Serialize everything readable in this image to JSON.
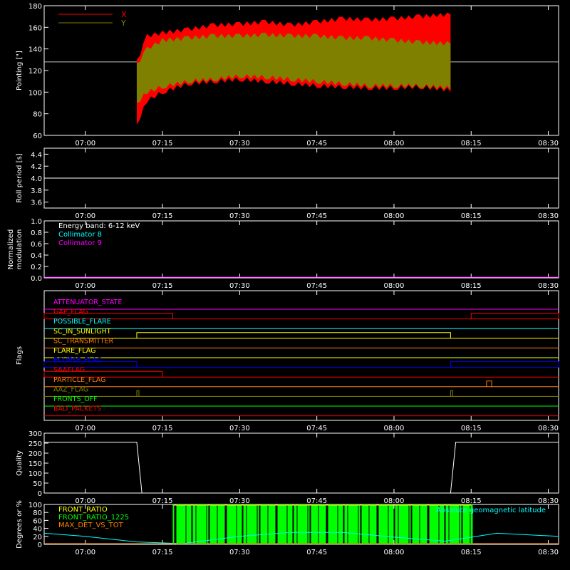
{
  "x_ticks": [
    "07:00",
    "07:15",
    "07:30",
    "07:45",
    "08:00",
    "08:15",
    "08:30"
  ],
  "colors": {
    "bg": "#000000",
    "axis": "#ffffff",
    "red": "#ff0000",
    "olive": "#808000",
    "cyan": "#00ffff",
    "magenta": "#ff00ff",
    "green": "#00ff00",
    "yellow": "#ffff00",
    "orange": "#ff7f00",
    "blue": "#0000ff"
  },
  "chart_data": [
    {
      "id": "pointing",
      "type": "area",
      "ylabel": "Pointing [\"]",
      "ylim": [
        60,
        180
      ],
      "yticks": [
        "60",
        "80",
        "100",
        "120",
        "140",
        "160",
        "180"
      ],
      "xlabel": "",
      "legend": {
        "placement": "top-left",
        "entries": [
          {
            "label": "X",
            "color": "#ff0000"
          },
          {
            "label": "Y",
            "color": "#808000"
          }
        ]
      },
      "baseline": 128,
      "x": [
        "07:10",
        "07:12",
        "07:15",
        "07:20",
        "07:25",
        "07:30",
        "07:35",
        "07:40",
        "07:45",
        "07:50",
        "07:55",
        "08:00",
        "08:05",
        "08:11"
      ],
      "series": [
        {
          "name": "X",
          "upper": [
            128,
            152,
            155,
            158,
            162,
            163,
            165,
            162,
            165,
            168,
            167,
            168,
            170,
            172
          ],
          "lower": [
            70,
            92,
            100,
            108,
            110,
            112,
            110,
            108,
            106,
            105,
            104,
            104,
            105,
            102
          ]
        },
        {
          "name": "Y",
          "upper": [
            125,
            140,
            148,
            150,
            152,
            152,
            153,
            152,
            152,
            150,
            150,
            148,
            146,
            145
          ],
          "lower": [
            90,
            100,
            105,
            110,
            112,
            115,
            114,
            112,
            110,
            108,
            106,
            106,
            106,
            104
          ]
        }
      ]
    },
    {
      "id": "roll",
      "type": "line",
      "ylabel": "Roll period [s]",
      "ylim": [
        3.5,
        4.5
      ],
      "yticks": [
        "3.6",
        "3.8",
        "4.0",
        "4.2",
        "4.4"
      ],
      "series": [
        {
          "name": "",
          "x": [
            "06:52",
            "08:32"
          ],
          "values": [
            4.0,
            4.0
          ]
        }
      ]
    },
    {
      "id": "modulation",
      "type": "line",
      "ylabel": "Normalized modulation",
      "ylim": [
        0,
        1
      ],
      "yticks": [
        "0.0",
        "0.2",
        "0.4",
        "0.6",
        "0.8",
        "1.0"
      ],
      "legend": {
        "placement": "top-left",
        "entries": [
          {
            "label": "Energy band: 6-12 keV",
            "color": "#ffffff"
          },
          {
            "label": "Collimator 8",
            "color": "#00ffff"
          },
          {
            "label": "Collimator 9",
            "color": "#ff00ff"
          }
        ]
      },
      "series": [
        {
          "name": "Collimator 9",
          "x": [
            "06:52",
            "08:32"
          ],
          "values": [
            0,
            0
          ]
        }
      ]
    },
    {
      "id": "flags",
      "type": "line",
      "ylabel": "Flags",
      "flags": [
        {
          "label": "ATTENUATOR_STATE",
          "color": "#ff00ff",
          "segments": []
        },
        {
          "label": "GAP_FLAG",
          "color": "#ff0000",
          "segments": [
            [
              "06:52",
              "07:17"
            ],
            [
              "08:15",
              "08:32"
            ]
          ]
        },
        {
          "label": "POSSIBLE_FLARE",
          "color": "#00ffff",
          "segments": []
        },
        {
          "label": "SC_IN_SUNLIGHT",
          "color": "#ffff00",
          "segments": [
            [
              "07:10",
              "08:11"
            ]
          ]
        },
        {
          "label": "SC_TRANSMITTER",
          "color": "#ff7f00",
          "segments": []
        },
        {
          "label": "FLARE_FLAG",
          "color": "#ffff00",
          "segments": []
        },
        {
          "label": "ECLIPSE_FLAG",
          "color": "#0000ff",
          "segments": [
            [
              "06:52",
              "07:10"
            ],
            [
              "08:11",
              "08:32"
            ]
          ]
        },
        {
          "label": "SAAFLAG",
          "color": "#ff0000",
          "segments": [
            [
              "06:52",
              "07:15"
            ]
          ]
        },
        {
          "label": "PARTICLE_FLAG",
          "color": "#ff7f00",
          "segments": [
            [
              "08:18",
              "08:19"
            ]
          ]
        },
        {
          "label": "AAZ_FLAG",
          "color": "#808000",
          "segments": [
            [
              "07:10",
              "07:10"
            ],
            [
              "08:11",
              "08:11"
            ]
          ]
        },
        {
          "label": "FRONTS_OFF",
          "color": "#00ff00",
          "segments": []
        },
        {
          "label": "BAD_PACKETS",
          "color": "#ff0000",
          "segments": []
        }
      ]
    },
    {
      "id": "quality",
      "type": "line",
      "ylabel": "Quality",
      "ylim": [
        0,
        300
      ],
      "yticks": [
        "0",
        "50",
        "100",
        "150",
        "200",
        "250",
        "300"
      ],
      "series": [
        {
          "name": "",
          "x": [
            "06:52",
            "07:10",
            "07:11",
            "08:11",
            "08:12",
            "08:32"
          ],
          "values": [
            255,
            255,
            0,
            0,
            255,
            255
          ]
        }
      ]
    },
    {
      "id": "ratio",
      "type": "bar",
      "ylabel": "Degrees or %",
      "ylim": [
        0,
        100
      ],
      "yticks": [
        "0",
        "20",
        "40",
        "60",
        "80",
        "100"
      ],
      "legend": {
        "placement": "top-left",
        "entries": [
          {
            "label": "FRONT_RATIO",
            "color": "#ffff00"
          },
          {
            "label": "FRONT_RATIO_1225",
            "color": "#00ff00"
          },
          {
            "label": "MAX_DET_VS_TOT",
            "color": "#ff7f00"
          }
        ]
      },
      "annotation": {
        "label": "Absolute geomagnetic latitude",
        "color": "#00ffff",
        "placement": "top-right"
      },
      "green_bars": {
        "x_range": [
          "07:17",
          "08:15"
        ],
        "value": 100
      },
      "latitude": {
        "x": [
          "06:52",
          "07:00",
          "07:10",
          "07:19",
          "07:30",
          "07:40",
          "07:50",
          "08:00",
          "08:10",
          "08:20",
          "08:32"
        ],
        "values": [
          28,
          20,
          6,
          2,
          20,
          30,
          30,
          18,
          8,
          28,
          20
        ]
      }
    }
  ]
}
